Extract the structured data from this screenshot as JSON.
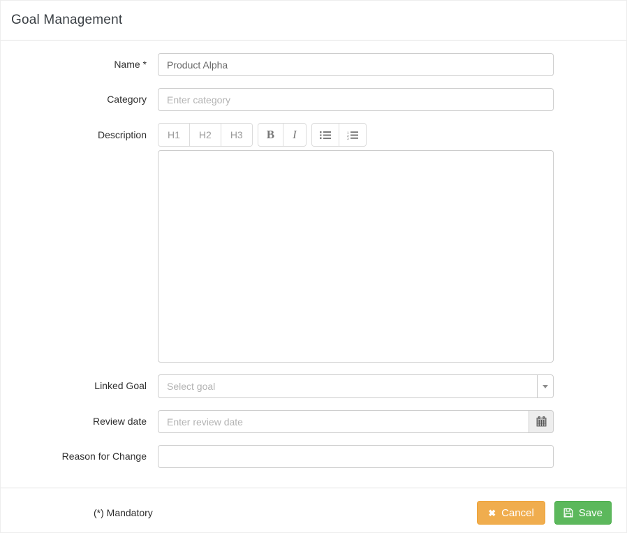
{
  "header": {
    "title": "Goal Management"
  },
  "form": {
    "name": {
      "label": "Name *",
      "value": "Product Alpha"
    },
    "category": {
      "label": "Category",
      "placeholder": "Enter category"
    },
    "description": {
      "label": "Description",
      "value": "",
      "toolbar": {
        "h1": "H1",
        "h2": "H2",
        "h3": "H3",
        "bold": "B",
        "italic": "I",
        "unordered_list_icon": "list-ul-icon",
        "ordered_list_icon": "list-ol-icon"
      }
    },
    "linked_goal": {
      "label": "Linked Goal",
      "placeholder": "Select goal",
      "dropdown_icon": "chevron-down-icon"
    },
    "review_date": {
      "label": "Review date",
      "placeholder": "Enter review date",
      "addon_icon": "calendar-icon"
    },
    "reason_for_change": {
      "label": "Reason for Change",
      "value": ""
    }
  },
  "footer": {
    "mandatory_note": "(*) Mandatory",
    "cancel_label": "Cancel",
    "cancel_icon_glyph": "✖",
    "save_label": "Save",
    "save_icon": "floppy-disk-icon"
  },
  "colors": {
    "cancel_bg": "#f0ad4e",
    "cancel_border": "#eea236",
    "save_bg": "#5cb85c",
    "save_border": "#4cae4c",
    "input_border": "#cccccc",
    "placeholder": "#b3b3b3",
    "divider": "#e4e4e4"
  }
}
